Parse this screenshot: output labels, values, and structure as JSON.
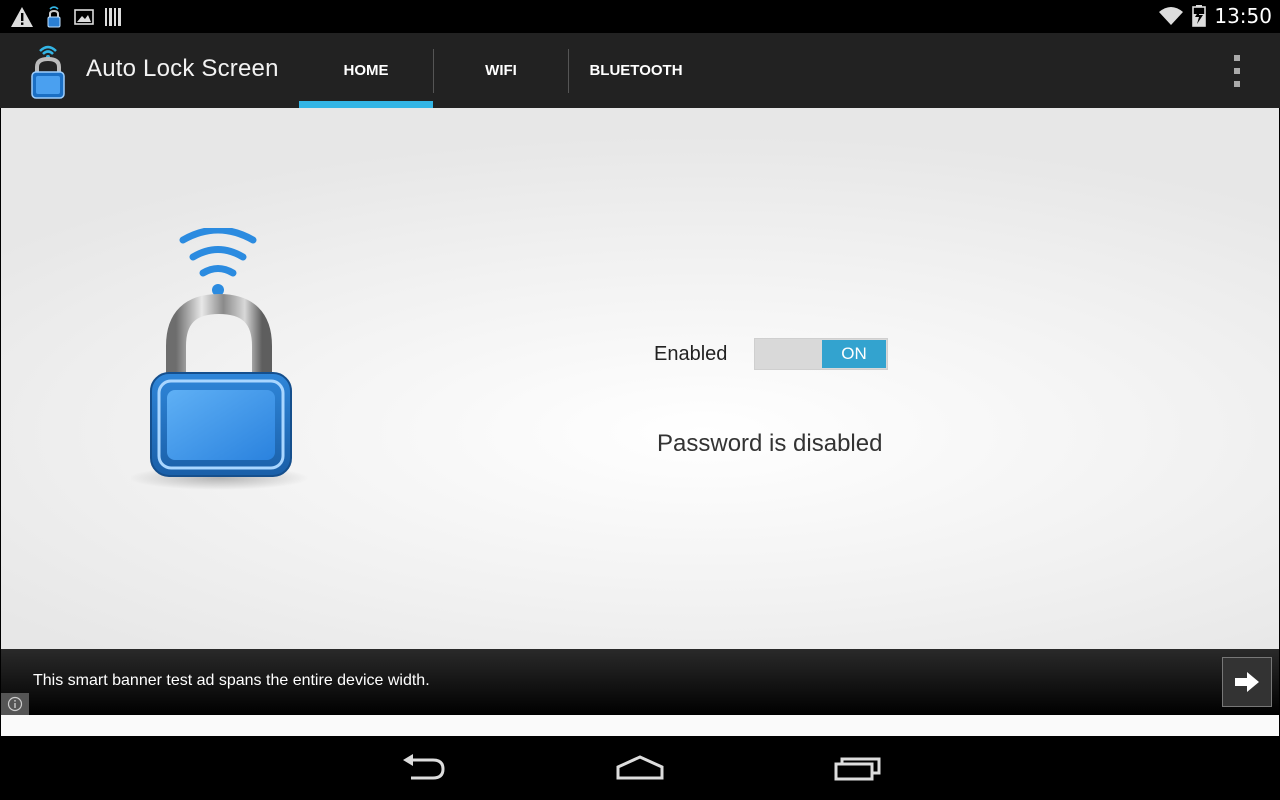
{
  "status_bar": {
    "time": "13:50",
    "left_icons": [
      "warning-icon",
      "lock-notification-icon",
      "image-icon",
      "barcode-icon"
    ],
    "right_icons": [
      "wifi-signal-icon",
      "battery-charging-icon"
    ]
  },
  "action_bar": {
    "title": "Auto Lock Screen",
    "tabs": [
      {
        "label": "HOME",
        "selected": true
      },
      {
        "label": "WIFI",
        "selected": false
      },
      {
        "label": "BLUETOOTH",
        "selected": false
      }
    ],
    "accent_color": "#33b5e5"
  },
  "main": {
    "enabled_label": "Enabled",
    "toggle": {
      "state_label": "ON",
      "checked": true,
      "color": "#33a3cf"
    },
    "password_status": "Password is disabled"
  },
  "ad_banner": {
    "text": "This smart banner test ad spans the entire device width."
  },
  "nav_bar": {
    "buttons": [
      "back-icon",
      "home-icon",
      "recent-apps-icon"
    ]
  }
}
